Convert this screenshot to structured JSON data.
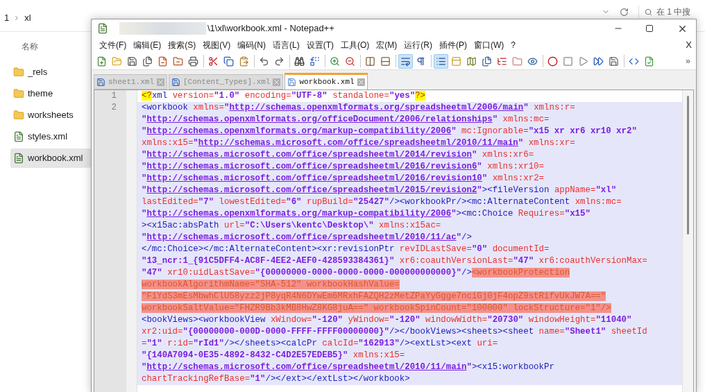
{
  "explorer": {
    "breadcrumb": [
      "1",
      "xl"
    ],
    "search": {
      "placeholder": "在 1 中搜"
    },
    "column_header": "名称",
    "items": [
      {
        "kind": "folder",
        "name": "_rels",
        "selected": false
      },
      {
        "kind": "folder",
        "name": "theme",
        "selected": false
      },
      {
        "kind": "folder",
        "name": "worksheets",
        "selected": false
      },
      {
        "kind": "file",
        "name": "styles.xml",
        "selected": false
      },
      {
        "kind": "file",
        "name": "workbook.xml",
        "selected": true
      }
    ]
  },
  "editor_window": {
    "title": "\\1\\xl\\workbook.xml - Notepad++",
    "menu": [
      "文件(F)",
      "编辑(E)",
      "搜索(S)",
      "视图(V)",
      "编码(N)",
      "语言(L)",
      "设置(T)",
      "工具(O)",
      "宏(M)",
      "运行(R)",
      "插件(P)",
      "窗口(W)",
      "?"
    ],
    "menu_close": "X",
    "toolbar": [
      {
        "on": false
      },
      {
        "on": false
      },
      {
        "on": false
      },
      {
        "on": false
      },
      {
        "on": false
      },
      {
        "on": false
      },
      {
        "on": false
      },
      {
        "on": false
      },
      {
        "on": false
      },
      {
        "on": false
      },
      {
        "on": false
      },
      {
        "on": false
      },
      {
        "on": false
      },
      {
        "on": false
      },
      {
        "on": false
      },
      {
        "on": false
      },
      {
        "on": false
      },
      {
        "on": false
      },
      {
        "on": true
      },
      {
        "on": false
      },
      {
        "on": true
      },
      {
        "on": false
      },
      {
        "on": false
      },
      {
        "on": false
      },
      {
        "on": false
      },
      {
        "on": false
      },
      {
        "on": false
      },
      {
        "on": false
      },
      {
        "on": false
      },
      {
        "on": false
      },
      {
        "on": false
      },
      {
        "on": false
      },
      {
        "on": false
      },
      {
        "on": false
      }
    ],
    "toolbar_overflow": "»",
    "tabs": [
      {
        "label": "sheet1.xml",
        "selected": false
      },
      {
        "label": "[Content_Types].xml",
        "selected": false
      },
      {
        "label": "workbook.xml",
        "selected": true
      }
    ],
    "lines": [
      {
        "number": "1",
        "current": false,
        "rows": [
          {
            "segments": [
              {
                "kind": "brace",
                "text": "<?"
              },
              {
                "kind": "tag",
                "text": "xml "
              },
              {
                "kind": "attr",
                "text": "version="
              },
              {
                "kind": "value",
                "text": "\"1.0\" "
              },
              {
                "kind": "attr",
                "text": "encoding="
              },
              {
                "kind": "value",
                "text": "\"UTF-8\" "
              },
              {
                "kind": "attr",
                "text": "standalone="
              },
              {
                "kind": "value",
                "text": "\"yes\""
              },
              {
                "kind": "brace",
                "text": "?>"
              }
            ]
          }
        ]
      },
      {
        "number": "2",
        "current": true,
        "rows": [
          {
            "segments": [
              {
                "kind": "tag",
                "text": "<workbook "
              },
              {
                "kind": "attr",
                "text": "xmlns="
              },
              {
                "kind": "value",
                "text": "\""
              },
              {
                "kind": "url",
                "text": "http://schemas.openxmlformats.org/spreadsheetml/2006/main"
              },
              {
                "kind": "value",
                "text": "\" "
              },
              {
                "kind": "attr",
                "text": "xmlns:r="
              }
            ]
          },
          {
            "segments": [
              {
                "kind": "value",
                "text": "\""
              },
              {
                "kind": "url",
                "text": "http://schemas.openxmlformats.org/officeDocument/2006/relationships"
              },
              {
                "kind": "value",
                "text": "\" "
              },
              {
                "kind": "attr",
                "text": "xmlns:mc="
              }
            ]
          },
          {
            "segments": [
              {
                "kind": "value",
                "text": "\""
              },
              {
                "kind": "url",
                "text": "http://schemas.openxmlformats.org/markup-compatibility/2006"
              },
              {
                "kind": "value",
                "text": "\" "
              },
              {
                "kind": "attr",
                "text": "mc:Ignorable="
              },
              {
                "kind": "value",
                "text": "\"x15 xr xr6 xr10 xr2\""
              }
            ]
          },
          {
            "segments": [
              {
                "kind": "attr",
                "text": "xmlns:x15="
              },
              {
                "kind": "value",
                "text": "\""
              },
              {
                "kind": "url",
                "text": "http://schemas.microsoft.com/office/spreadsheetml/2010/11/main"
              },
              {
                "kind": "value",
                "text": "\" "
              },
              {
                "kind": "attr",
                "text": "xmlns:xr="
              }
            ]
          },
          {
            "segments": [
              {
                "kind": "value",
                "text": "\""
              },
              {
                "kind": "url",
                "text": "http://schemas.microsoft.com/office/spreadsheetml/2014/revision"
              },
              {
                "kind": "value",
                "text": "\" "
              },
              {
                "kind": "attr",
                "text": "xmlns:xr6="
              }
            ]
          },
          {
            "segments": [
              {
                "kind": "value",
                "text": "\""
              },
              {
                "kind": "url",
                "text": "http://schemas.microsoft.com/office/spreadsheetml/2016/revision6"
              },
              {
                "kind": "value",
                "text": "\" "
              },
              {
                "kind": "attr",
                "text": "xmlns:xr10="
              }
            ]
          },
          {
            "segments": [
              {
                "kind": "value",
                "text": "\""
              },
              {
                "kind": "url",
                "text": "http://schemas.microsoft.com/office/spreadsheetml/2016/revision10"
              },
              {
                "kind": "value",
                "text": "\" "
              },
              {
                "kind": "attr",
                "text": "xmlns:xr2="
              }
            ]
          },
          {
            "segments": [
              {
                "kind": "value",
                "text": "\""
              },
              {
                "kind": "url",
                "text": "http://schemas.microsoft.com/office/spreadsheetml/2015/revision2"
              },
              {
                "kind": "value",
                "text": "\""
              },
              {
                "kind": "tag",
                "text": "><fileVersion "
              },
              {
                "kind": "attr",
                "text": "appName="
              },
              {
                "kind": "value",
                "text": "\"xl\""
              }
            ]
          },
          {
            "segments": [
              {
                "kind": "attr",
                "text": "lastEdited="
              },
              {
                "kind": "value",
                "text": "\"7\" "
              },
              {
                "kind": "attr",
                "text": "lowestEdited="
              },
              {
                "kind": "value",
                "text": "\"6\" "
              },
              {
                "kind": "attr",
                "text": "rupBuild="
              },
              {
                "kind": "value",
                "text": "\"25427\""
              },
              {
                "kind": "tag",
                "text": "/><workbookPr/><mc:AlternateContent "
              },
              {
                "kind": "attr",
                "text": "xmlns:mc="
              }
            ]
          },
          {
            "segments": [
              {
                "kind": "value",
                "text": "\""
              },
              {
                "kind": "url",
                "text": "http://schemas.openxmlformats.org/markup-compatibility/2006"
              },
              {
                "kind": "value",
                "text": "\""
              },
              {
                "kind": "tag",
                "text": "><mc:Choice "
              },
              {
                "kind": "attr",
                "text": "Requires="
              },
              {
                "kind": "value",
                "text": "\"x15\""
              }
            ]
          },
          {
            "segments": [
              {
                "kind": "tag",
                "text": "><x15ac:absPath "
              },
              {
                "kind": "attr",
                "text": "url="
              },
              {
                "kind": "value",
                "text": "\"C:\\Users\\kentc\\Desktop\\\" "
              },
              {
                "kind": "attr",
                "text": "xmlns:x15ac="
              }
            ]
          },
          {
            "segments": [
              {
                "kind": "value",
                "text": "\""
              },
              {
                "kind": "url",
                "text": "http://schemas.microsoft.com/office/spreadsheetml/2010/11/ac"
              },
              {
                "kind": "value",
                "text": "\""
              },
              {
                "kind": "tag",
                "text": "/>"
              }
            ]
          },
          {
            "segments": [
              {
                "kind": "tag",
                "text": "</mc:Choice></mc:AlternateContent><xr:revisionPtr "
              },
              {
                "kind": "attr",
                "text": "revIDLastSave="
              },
              {
                "kind": "value",
                "text": "\"0\" "
              },
              {
                "kind": "attr",
                "text": "documentId="
              }
            ]
          },
          {
            "segments": [
              {
                "kind": "value",
                "text": "\"13_ncr:1_{91C5DFF4-AC8F-4EE2-AEF0-428593384361}\" "
              },
              {
                "kind": "attr",
                "text": "xr6:coauthVersionLast="
              },
              {
                "kind": "value",
                "text": "\"47\" "
              },
              {
                "kind": "attr",
                "text": "xr6:coauthVersionMax="
              }
            ]
          },
          {
            "segments": [
              {
                "kind": "value",
                "text": "\"47\" "
              },
              {
                "kind": "attr",
                "text": "xr10:uidLastSave="
              },
              {
                "kind": "value",
                "text": "\"{00000000-0000-0000-0000-000000000000}\""
              },
              {
                "kind": "tag",
                "text": "/>"
              },
              {
                "kind": "marked",
                "text": "<workbookProtection"
              }
            ]
          },
          {
            "segments": [
              {
                "kind": "marked",
                "text": "workbookAlgorithmName=\"SHA-512\" workbookHashValue="
              }
            ]
          },
          {
            "segments": [
              {
                "kind": "marked",
                "text": "\"F1YdS3mEsMbwhClU58yzz2jP8yqR4N6DYwEm6MRxhFAZQH2zMetZPaYyGgge7nciGj0jF4opZ9stRifvUkJW7A==\""
              }
            ]
          },
          {
            "segments": [
              {
                "kind": "marked",
                "text": "workbookSaltValue=\"FHZR9Bb3kMB8HwZ8KG8juA==\" workbookSpinCount=\"100000\" lockStructure=\"1\"/>"
              }
            ]
          },
          {
            "segments": [
              {
                "kind": "tag",
                "text": "<bookViews><workbookView "
              },
              {
                "kind": "attr",
                "text": "xWindow="
              },
              {
                "kind": "value",
                "text": "\"-120\" "
              },
              {
                "kind": "attr",
                "text": "yWindow="
              },
              {
                "kind": "value",
                "text": "\"-120\" "
              },
              {
                "kind": "attr",
                "text": "windowWidth="
              },
              {
                "kind": "value",
                "text": "\"20730\" "
              },
              {
                "kind": "attr",
                "text": "windowHeight="
              },
              {
                "kind": "value",
                "text": "\"11040\""
              }
            ]
          },
          {
            "segments": [
              {
                "kind": "attr",
                "text": "xr2:uid="
              },
              {
                "kind": "value",
                "text": "\"{00000000-000D-0000-FFFF-FFFF00000000}\""
              },
              {
                "kind": "tag",
                "text": "/></bookViews><sheets><sheet "
              },
              {
                "kind": "attr",
                "text": "name="
              },
              {
                "kind": "value",
                "text": "\"Sheet1\" "
              },
              {
                "kind": "attr",
                "text": "sheetId"
              }
            ]
          },
          {
            "segments": [
              {
                "kind": "attr",
                "text": "="
              },
              {
                "kind": "value",
                "text": "\"1\" "
              },
              {
                "kind": "attr",
                "text": "r:id="
              },
              {
                "kind": "value",
                "text": "\"rId1\""
              },
              {
                "kind": "tag",
                "text": "/></sheets><calcPr "
              },
              {
                "kind": "attr",
                "text": "calcId="
              },
              {
                "kind": "value",
                "text": "\"162913\""
              },
              {
                "kind": "tag",
                "text": "/><extLst><ext "
              },
              {
                "kind": "attr",
                "text": "uri="
              }
            ]
          },
          {
            "segments": [
              {
                "kind": "value",
                "text": "\"{140A7094-0E35-4892-8432-C4D2E57EDEB5}\" "
              },
              {
                "kind": "attr",
                "text": "xmlns:x15="
              }
            ]
          },
          {
            "segments": [
              {
                "kind": "value",
                "text": "\""
              },
              {
                "kind": "url",
                "text": "http://schemas.microsoft.com/office/spreadsheetml/2010/11/main"
              },
              {
                "kind": "value",
                "text": "\""
              },
              {
                "kind": "tag",
                "text": "><x15:workbookPr"
              }
            ]
          },
          {
            "segments": [
              {
                "kind": "attr",
                "text": "chartTrackingRefBase="
              },
              {
                "kind": "value",
                "text": "\"1\""
              },
              {
                "kind": "tag",
                "text": "/></ext></extLst></workbook>"
              }
            ]
          }
        ]
      }
    ]
  }
}
